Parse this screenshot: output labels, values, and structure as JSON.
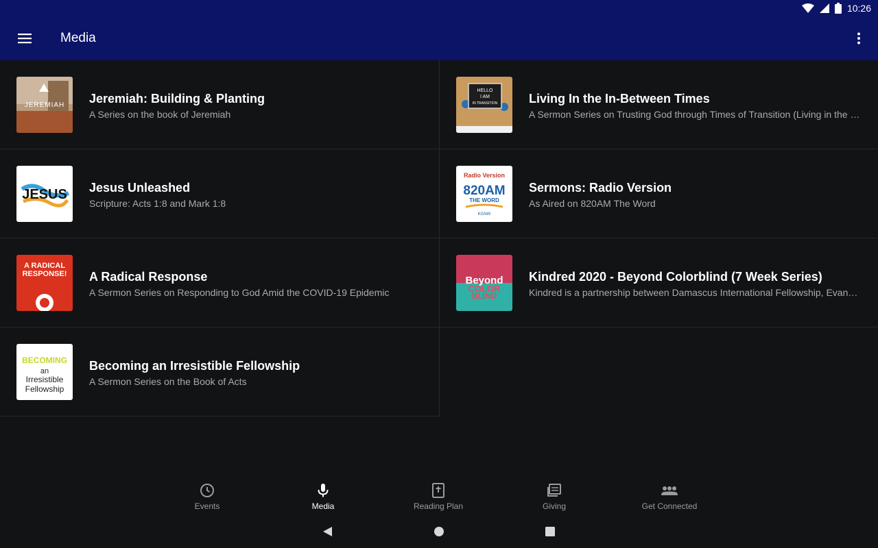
{
  "status": {
    "time": "10:26"
  },
  "appbar": {
    "title": "Media"
  },
  "items": [
    {
      "title": "Jeremiah: Building & Planting",
      "subtitle": "A Series on the book of Jeremiah",
      "thumb_text": "JEREMIAH"
    },
    {
      "title": "Living In the In-Between Times",
      "subtitle": "A Sermon Series on Trusting God through Times of Transition (Living in the L…",
      "thumb_text": "HELLO I AM IN TRANSITION"
    },
    {
      "title": "Jesus Unleashed",
      "subtitle": "Scripture: Acts 1:8 and Mark 1:8",
      "thumb_text": "JESUS"
    },
    {
      "title": "Sermons: Radio Version",
      "subtitle": "As Aired on 820AM The Word",
      "thumb_text_1": "Radio Version",
      "thumb_text_2": "820AM",
      "thumb_text_3": "THE WORD",
      "thumb_text_4": "KGNW"
    },
    {
      "title": "A Radical Response",
      "subtitle": "A Sermon Series on Responding to God Amid the COVID-19 Epidemic",
      "thumb_text": "A RADICAL RESPONSE!"
    },
    {
      "title": "Kindred 2020 - Beyond Colorblind (7 Week Series)",
      "subtitle": "Kindred is a partnership between Damascus International Fellowship, Evange…",
      "thumb_text_1": "Beyond",
      "thumb_text_2": "COLOR",
      "thumb_text_3": "BLIND"
    },
    {
      "title": "Becoming an Irresistible Fellowship",
      "subtitle": "A Sermon Series on the Book of Acts",
      "thumb_text_1": "BECOMING",
      "thumb_text_2": "an",
      "thumb_text_3": "Irresistible",
      "thumb_text_4": "Fellowship"
    }
  ],
  "nav": [
    {
      "label": "Events",
      "icon": "clock-icon"
    },
    {
      "label": "Media",
      "icon": "microphone-icon",
      "active": true
    },
    {
      "label": "Reading Plan",
      "icon": "bible-icon"
    },
    {
      "label": "Giving",
      "icon": "giving-icon"
    },
    {
      "label": "Get Connected",
      "icon": "group-icon"
    }
  ],
  "colors": {
    "appbar": "#0b1466",
    "background": "#121315",
    "divider": "#26282b",
    "subtitle": "#a9abad"
  }
}
